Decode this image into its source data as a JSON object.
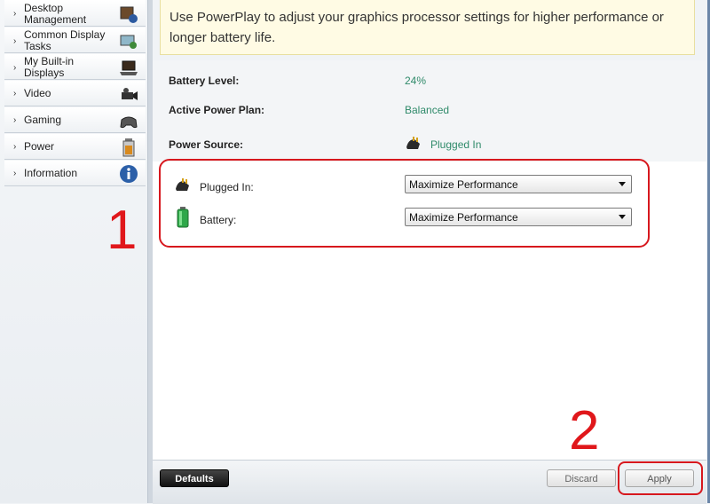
{
  "sidebar": {
    "items": [
      {
        "label": "Desktop Management",
        "icon": "desktop-management-icon"
      },
      {
        "label": "Common Display Tasks",
        "icon": "display-tasks-icon"
      },
      {
        "label": "My Built-in Displays",
        "icon": "laptop-icon"
      },
      {
        "label": "Video",
        "icon": "video-camera-icon"
      },
      {
        "label": "Gaming",
        "icon": "gamepad-icon"
      },
      {
        "label": "Power",
        "icon": "battery-icon"
      },
      {
        "label": "Information",
        "icon": "info-icon"
      }
    ]
  },
  "banner": {
    "text": "Use PowerPlay to adjust your graphics processor settings for higher performance or longer battery life."
  },
  "status": {
    "battery_level_label": "Battery Level:",
    "battery_level_value": "24%",
    "power_plan_label": "Active Power Plan:",
    "power_plan_value": "Balanced",
    "power_source_label": "Power Source:",
    "power_source_value": "Plugged In"
  },
  "settings": {
    "plugged_in_label": "Plugged In:",
    "plugged_in_value": "Maximize Performance",
    "battery_label": "Battery:",
    "battery_value": "Maximize Performance"
  },
  "annotations": {
    "marker_1": "1",
    "marker_2": "2"
  },
  "footer": {
    "defaults_label": "Defaults",
    "discard_label": "Discard",
    "apply_label": "Apply"
  },
  "colors": {
    "value_green": "#2f8a6a",
    "annotation_red": "#d7181e"
  }
}
